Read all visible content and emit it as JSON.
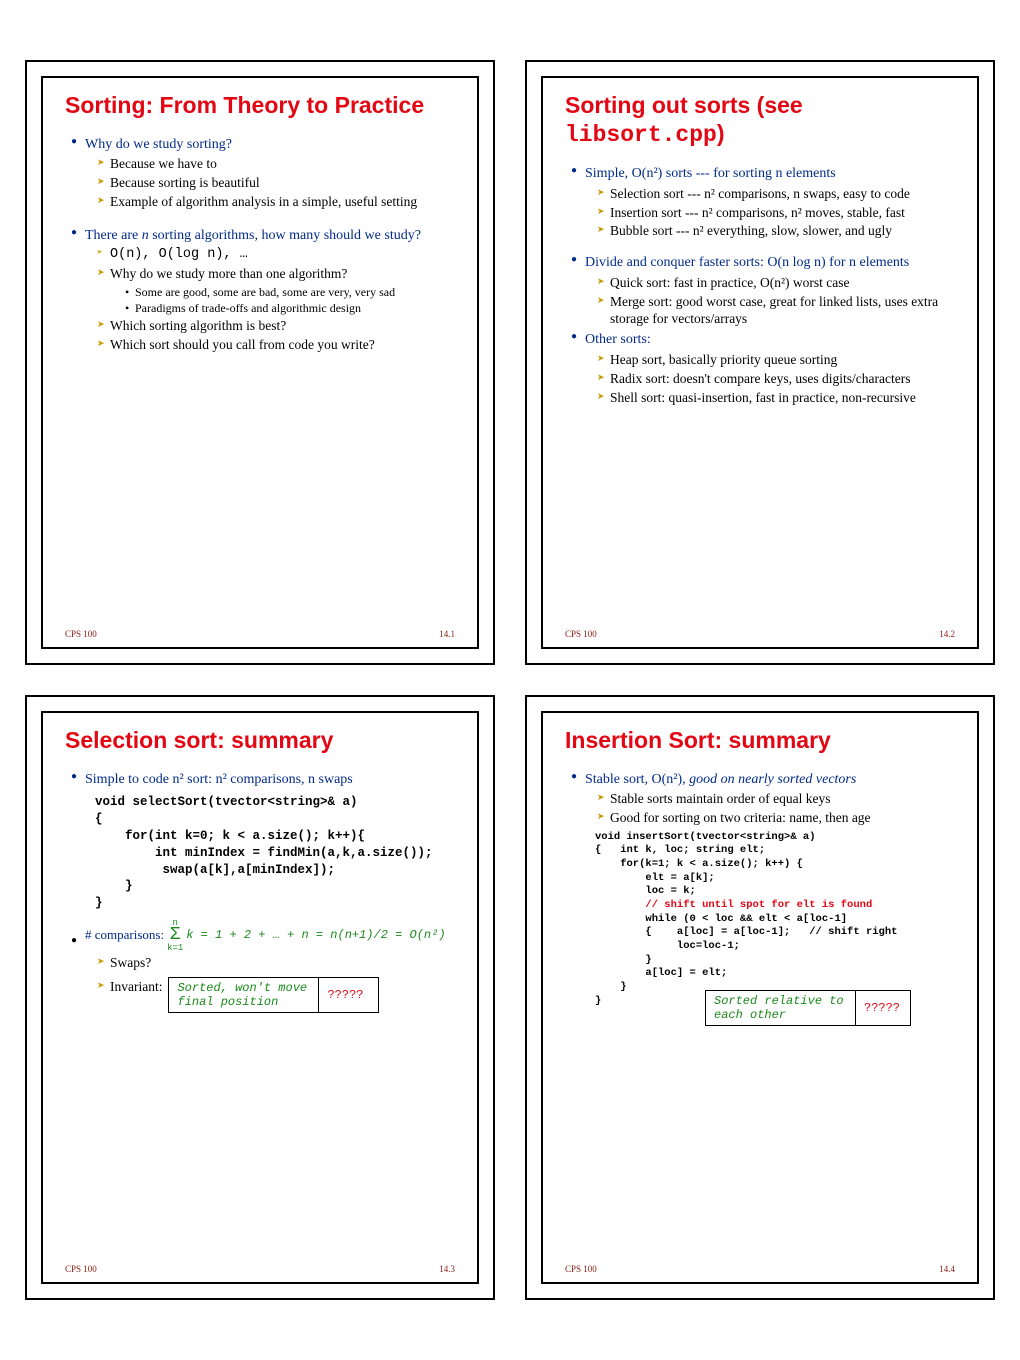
{
  "footer": {
    "course": "CPS 100"
  },
  "slides": {
    "s1": {
      "title": "Sorting: From Theory to Practice",
      "b1": "Why do we study sorting?",
      "b1a": "Because we have to",
      "b1b": "Because sorting is beautiful",
      "b1c": "Example of algorithm analysis in a simple, useful setting",
      "b2_pre": "There are ",
      "b2_mid": "n",
      "b2_post": " sorting algorithms, how many should we study?",
      "b2a": "O(n), O(log n), …",
      "b2b": "Why do we study more than one algorithm?",
      "b2b1": "Some are good, some are bad, some are very, very sad",
      "b2b2": "Paradigms of trade-offs and algorithmic design",
      "b2c": "Which sorting algorithm is best?",
      "b2d": "Which sort should you call from code you write?",
      "page": "14.1"
    },
    "s2": {
      "title_pre": "Sorting out sorts (see ",
      "title_code": "libsort.cpp",
      "title_post": ")",
      "b1": "Simple, O(n²) sorts --- for sorting n elements",
      "b1a": "Selection sort --- n² comparisons, n swaps, easy to code",
      "b1b": "Insertion sort --- n² comparisons, n² moves, stable, fast",
      "b1c": "Bubble sort --- n² everything, slow, slower, and ugly",
      "b2": "Divide and conquer faster sorts: O(n log n) for n elements",
      "b2a": "Quick sort: fast in practice, O(n²) worst case",
      "b2b": "Merge sort: good worst case, great for linked lists, uses extra storage for vectors/arrays",
      "b3": "Other sorts:",
      "b3a": "Heap sort, basically priority queue sorting",
      "b3b": "Radix sort: doesn't compare keys, uses digits/characters",
      "b3c": "Shell sort: quasi-insertion, fast in practice, non-recursive",
      "page": "14.2"
    },
    "s3": {
      "title": "Selection sort: summary",
      "b1": "Simple to code n² sort: n² comparisons, n swaps",
      "code": "void selectSort(tvector<string>& a)\n{\n    for(int k=0; k < a.size(); k++){\n        int minIndex = findMin(a,k,a.size());\n         swap(a[k],a[minIndex]);\n    }\n}",
      "b2_label": "# comparisons:",
      "b2_top": "n",
      "b2_bot": "k=1",
      "b2_formula": "k = 1 + 2 + … + n = n(n+1)/2 = O(n²)",
      "b2a": "Swaps?",
      "b2b": "Invariant:",
      "inv1": "Sorted, won't move\nfinal position",
      "inv2": "?????",
      "page": "14.3"
    },
    "s4": {
      "title": "Insertion Sort: summary",
      "b1_pre": "Stable sort, O(n²), ",
      "b1_it": "good on nearly sorted vectors",
      "b1a": "Stable sorts maintain order of equal keys",
      "b1b": "Good for sorting on two criteria: name, then age",
      "code1": "void insertSort(tvector<string>& a)\n{   int k, loc; string elt;\n    for(k=1; k < a.size(); k++) {\n        elt = a[k];\n        loc = k;",
      "code_comment": "        // shift until spot for elt is found",
      "code2": "        while (0 < loc && elt < a[loc-1]\n        {    a[loc] = a[loc-1];   // shift right\n             loc=loc-1;\n        }\n        a[loc] = elt;\n    }\n}",
      "inv1": "Sorted relative to\neach other",
      "inv2": "?????",
      "page": "14.4"
    }
  }
}
